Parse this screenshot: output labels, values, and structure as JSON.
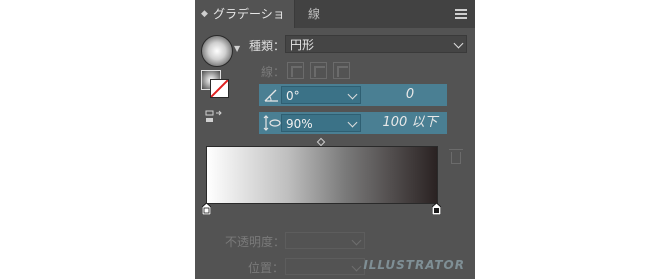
{
  "panel": {
    "title": "グラデーション",
    "tab_secondary": "線",
    "type_label": "種類：",
    "type_value": "円形",
    "stroke_label": "線：",
    "angle": {
      "value": "0°",
      "right_value": "0"
    },
    "aspect": {
      "value": "90%",
      "right_value": "100 以下"
    },
    "opacity_label": "不透明度：",
    "location_label": "位置：",
    "watermark": "ILLUSTRATOR"
  },
  "gradient": {
    "colors": [
      "#ffffff",
      "#bfbfbf",
      "#7a7a7a",
      "#2a2222"
    ]
  },
  "icons": [
    "gradient-swatch-icon",
    "fill-stroke-icon",
    "reverse-gradient-icon",
    "angle-icon",
    "aspect-ratio-icon",
    "trash-icon",
    "menu-icon"
  ]
}
